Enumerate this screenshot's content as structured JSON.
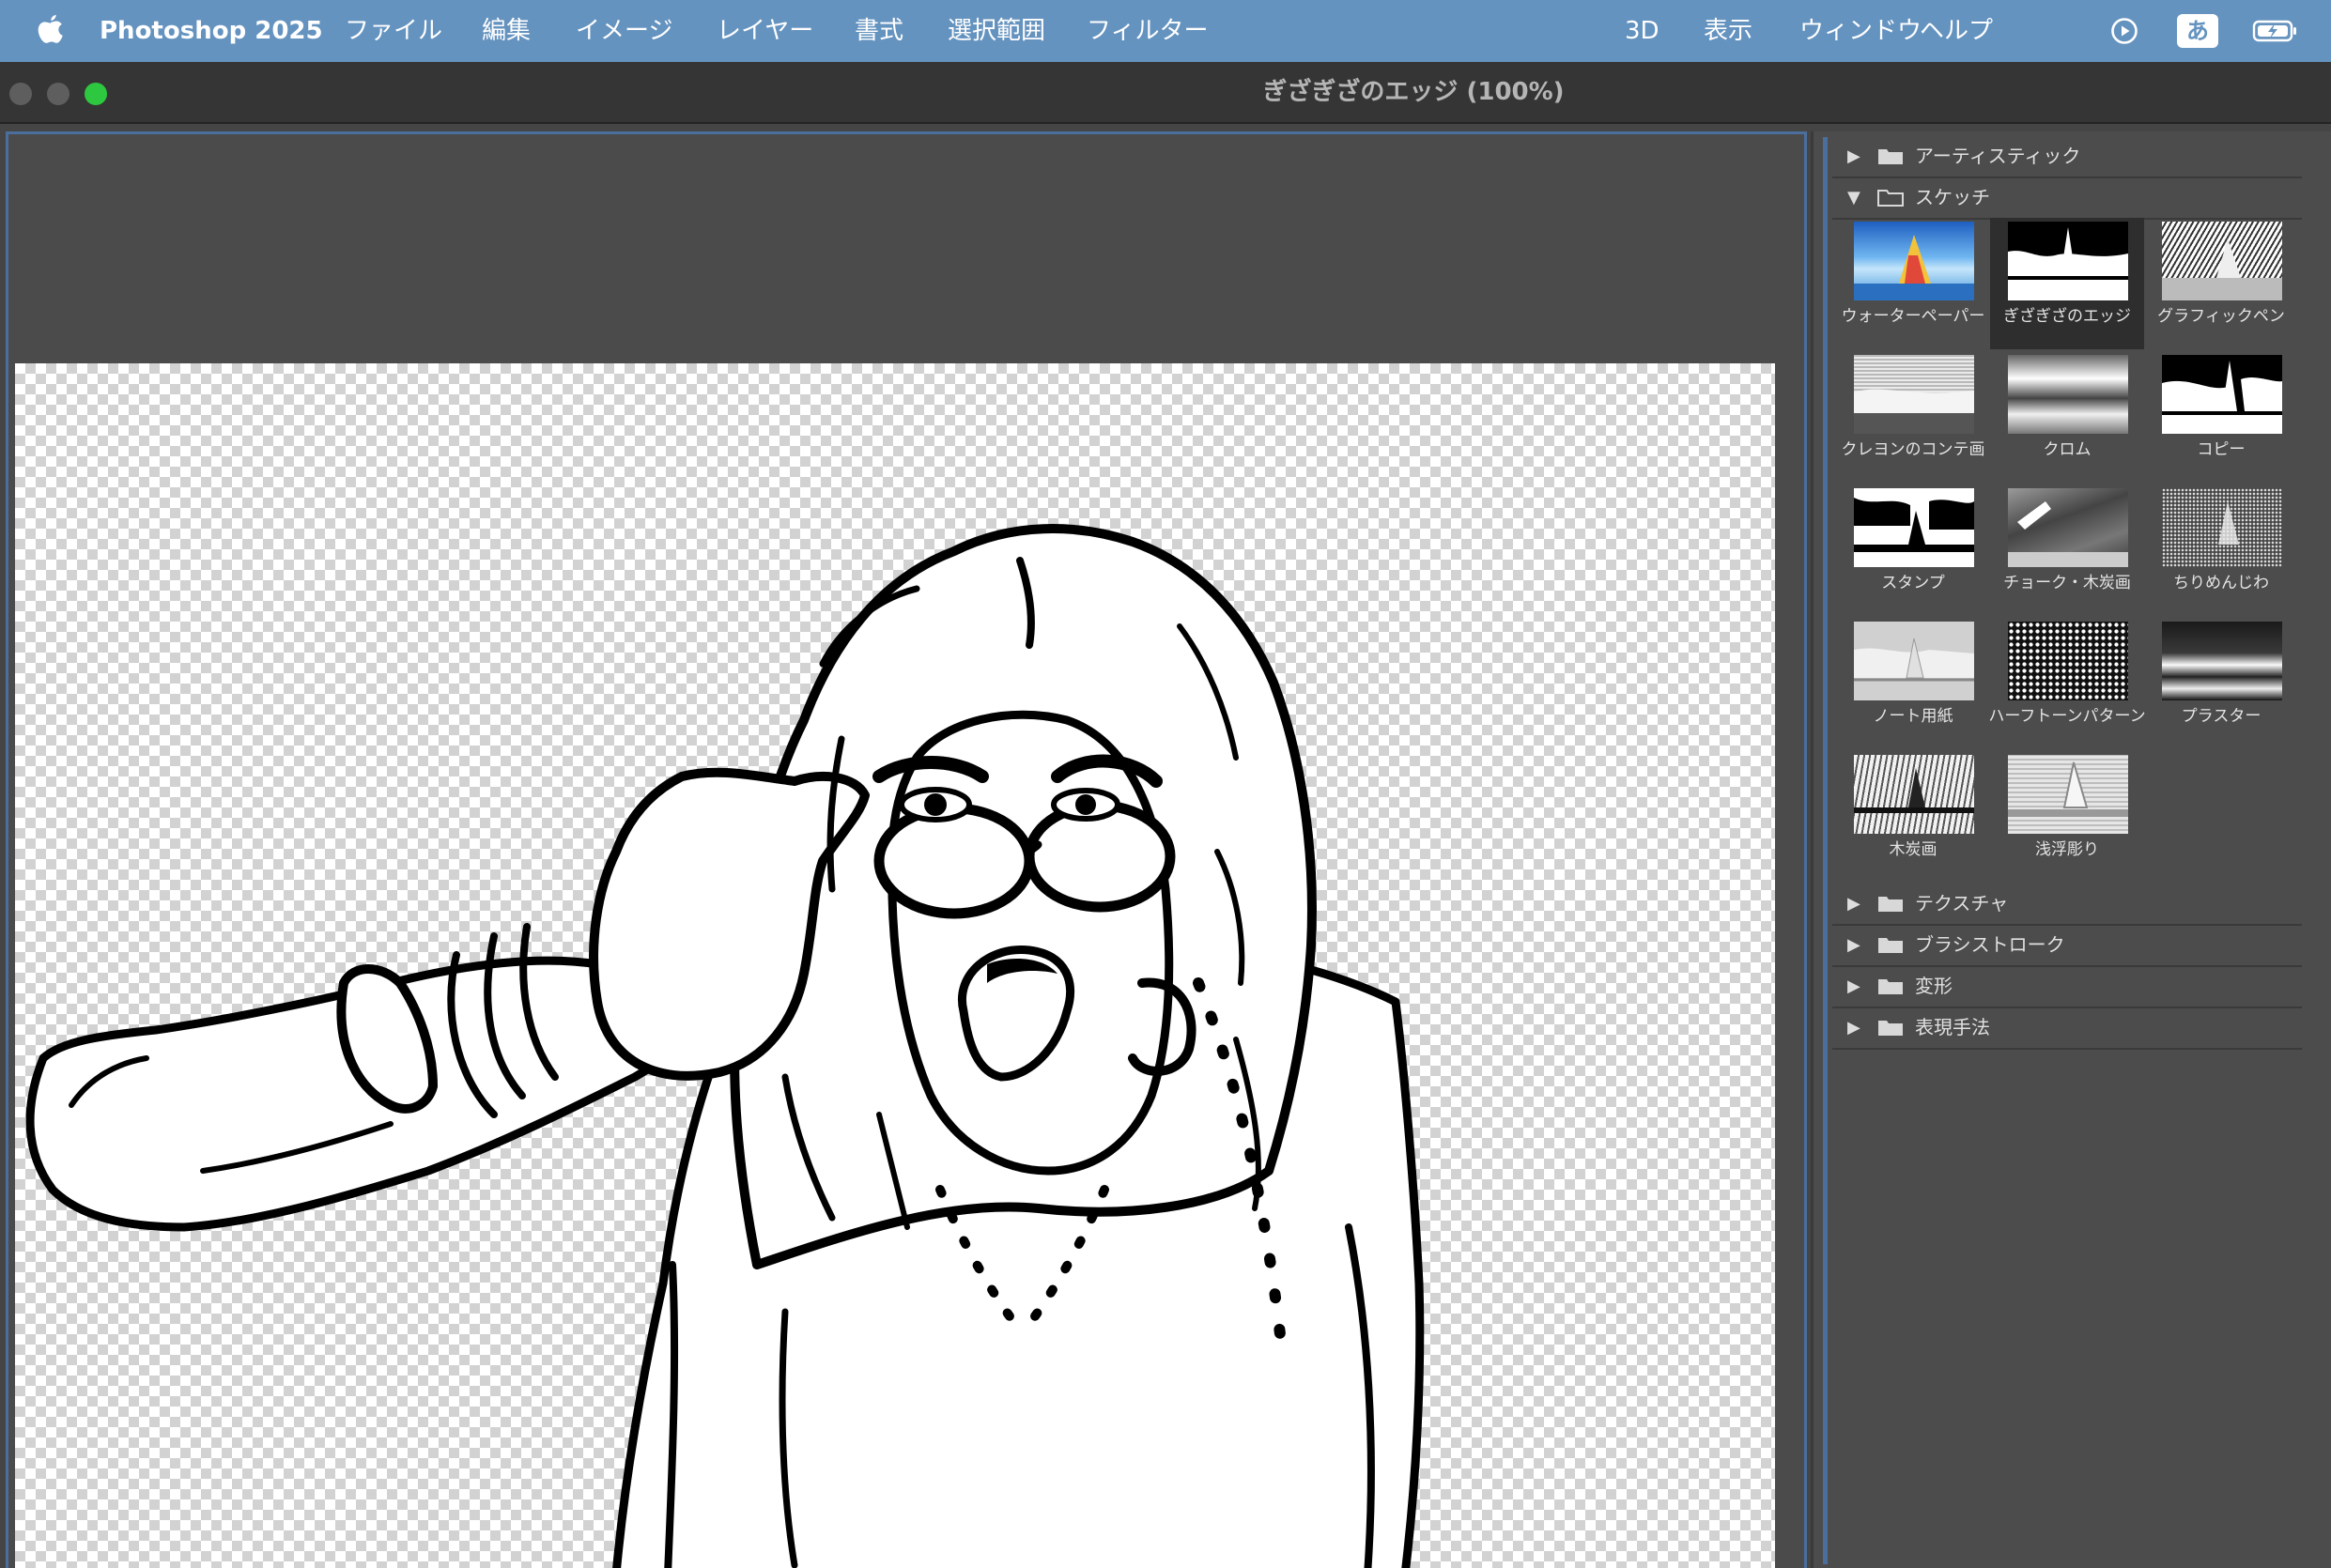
{
  "menubar": {
    "app_name": "Photoshop 2025",
    "items": [
      "ファイル",
      "編集",
      "イメージ",
      "レイヤー",
      "書式",
      "選択範囲",
      "フィルター",
      "3D",
      "表示",
      "ウィンドウ",
      "ヘルプ"
    ],
    "ime_label": "あ"
  },
  "window": {
    "title": "ぎざぎざのエッジ (100%)"
  },
  "filter_panel": {
    "categories_top": [
      {
        "label": "アーティスティック",
        "expanded": false
      },
      {
        "label": "スケッチ",
        "expanded": true
      }
    ],
    "sketch_filters": [
      {
        "label": "ウォーターペーパー",
        "selected": false
      },
      {
        "label": "ぎざぎざのエッジ",
        "selected": true
      },
      {
        "label": "グラフィックペン",
        "selected": false
      },
      {
        "label": "クレヨンのコンテ画",
        "selected": false
      },
      {
        "label": "クロム",
        "selected": false
      },
      {
        "label": "コピー",
        "selected": false
      },
      {
        "label": "スタンプ",
        "selected": false
      },
      {
        "label": "チョーク・木炭画",
        "selected": false
      },
      {
        "label": "ちりめんじわ",
        "selected": false
      },
      {
        "label": "ノート用紙",
        "selected": false
      },
      {
        "label": "ハーフトーンパターン",
        "selected": false
      },
      {
        "label": "プラスター",
        "selected": false
      },
      {
        "label": "木炭画",
        "selected": false
      },
      {
        "label": "浅浮彫り",
        "selected": false
      }
    ],
    "categories_bottom": [
      {
        "label": "テクスチャ"
      },
      {
        "label": "ブラシストローク"
      },
      {
        "label": "変形"
      },
      {
        "label": "表現手法"
      }
    ]
  },
  "colors": {
    "menubar": "#6593bf",
    "accent": "#4b6f9d",
    "close": "#5e5e5e",
    "zoom": "#2ec840"
  }
}
